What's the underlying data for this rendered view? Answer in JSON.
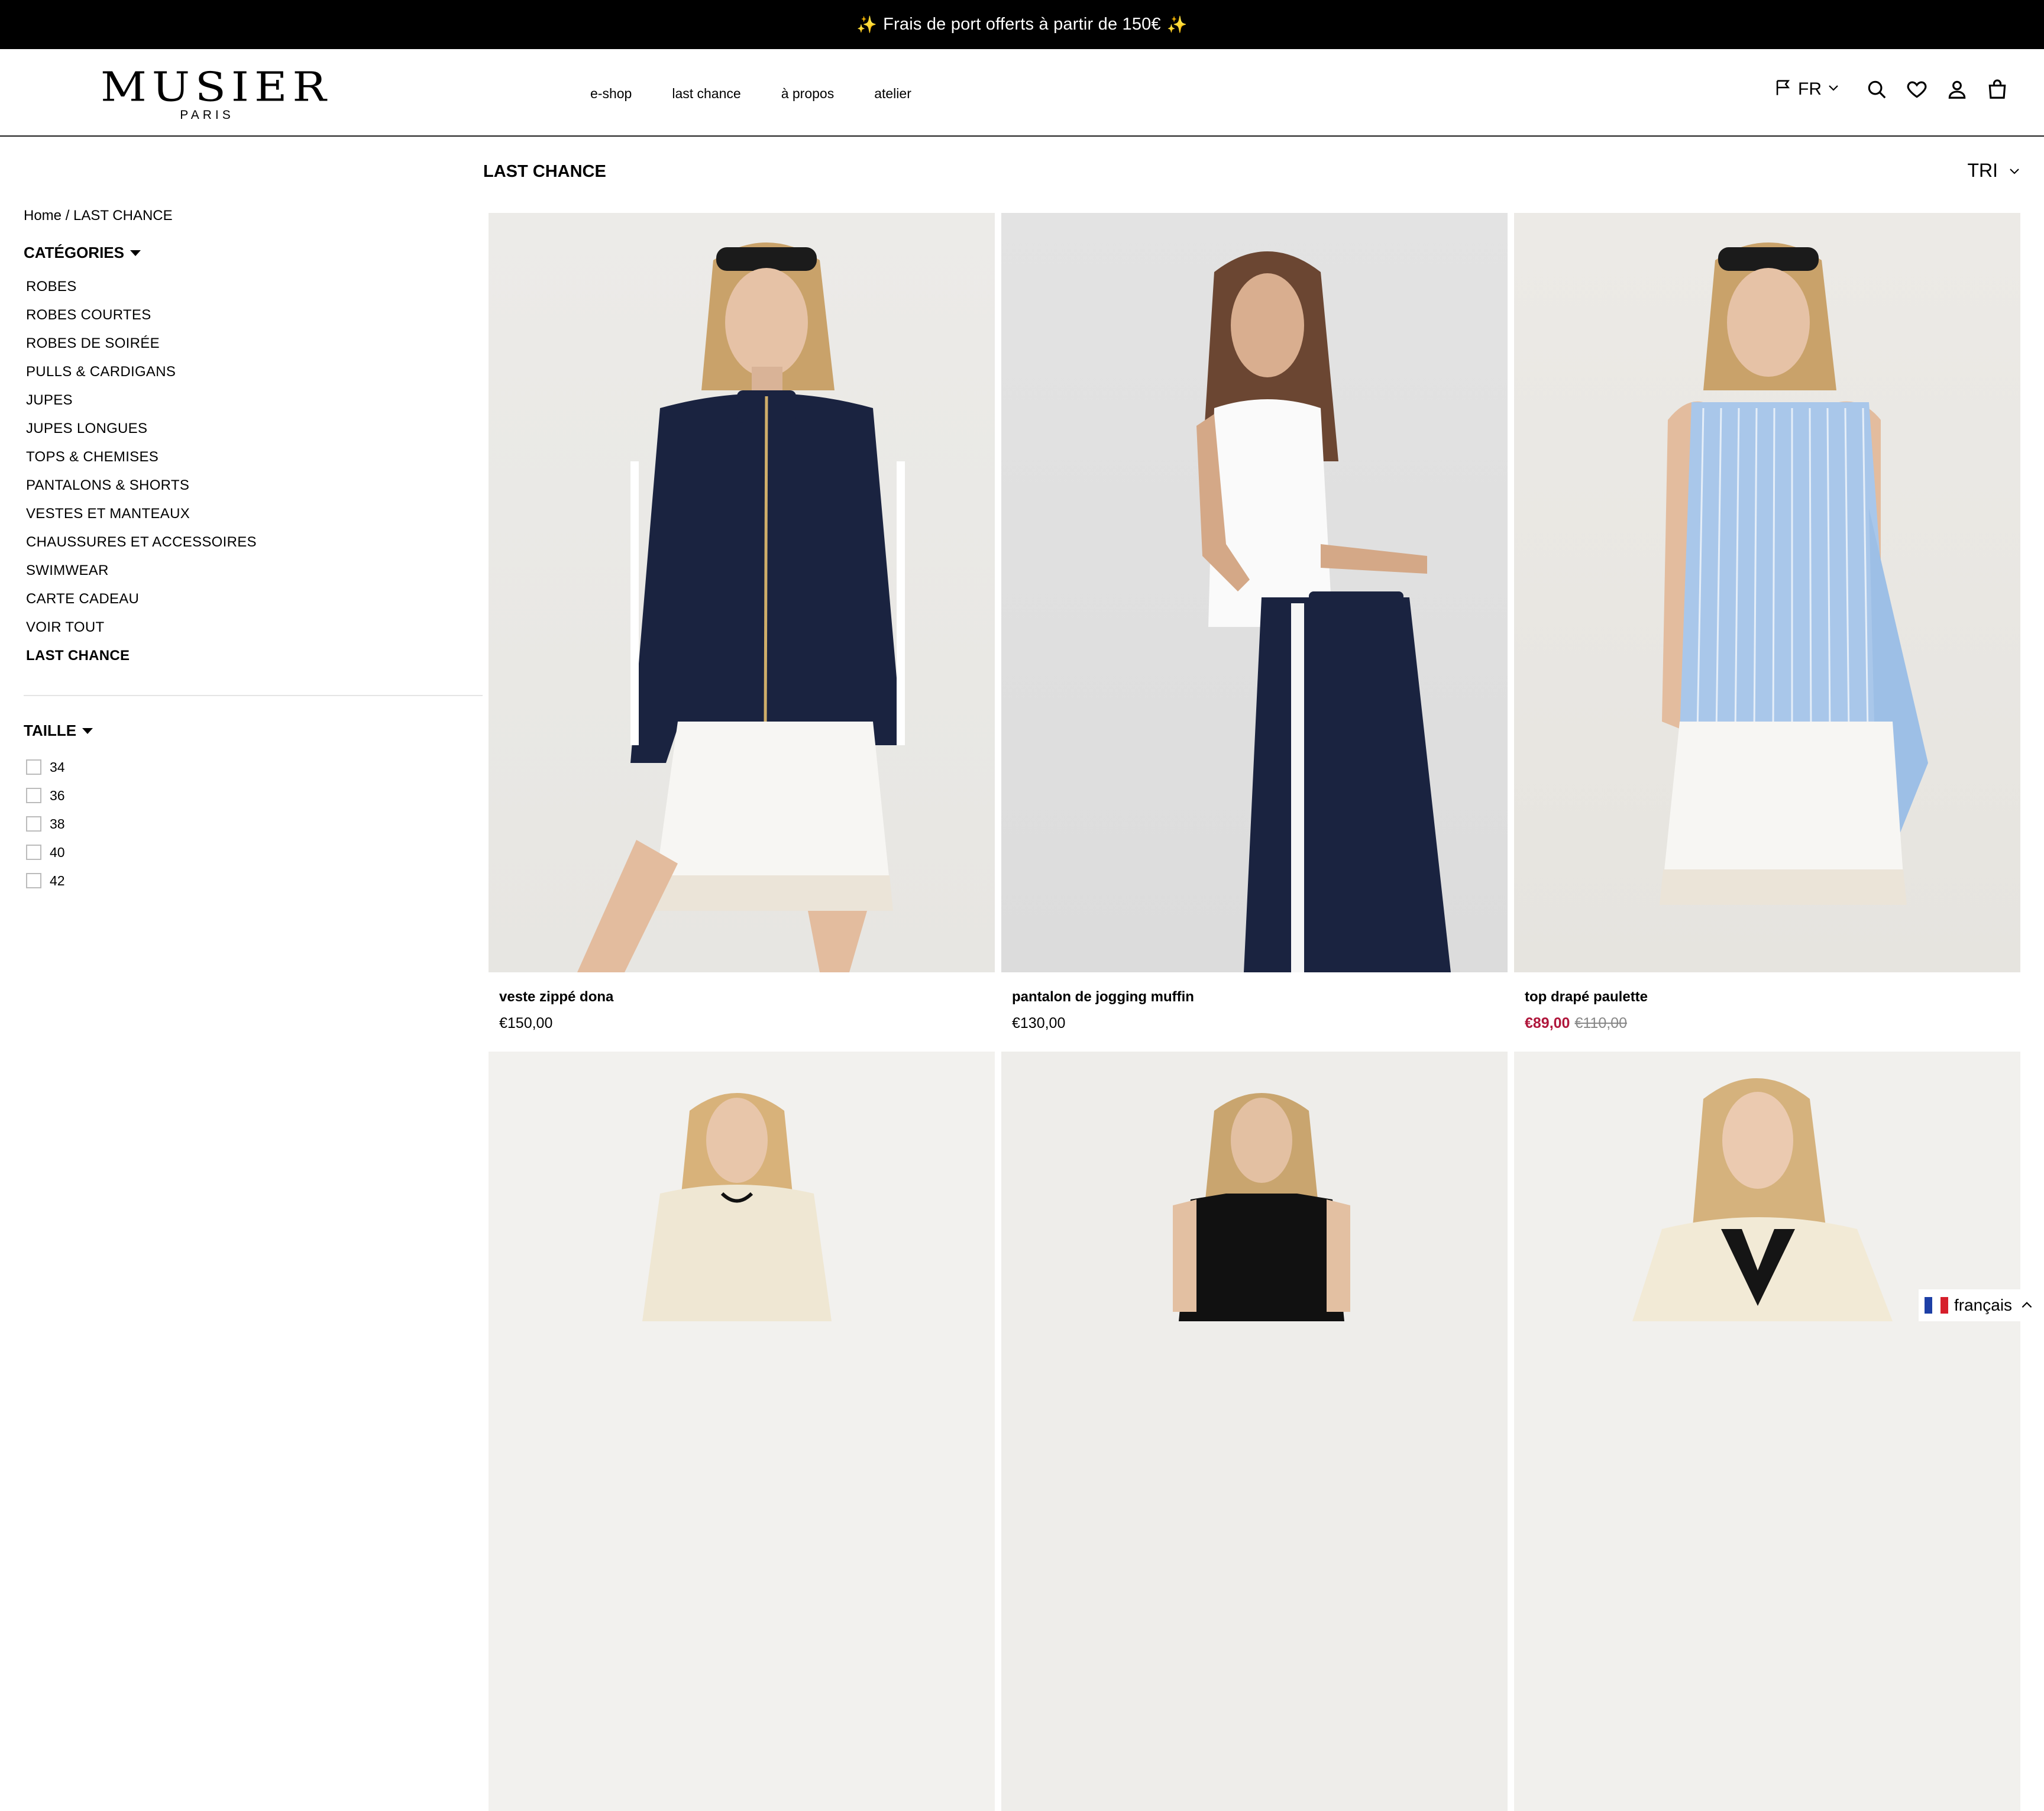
{
  "announcement": {
    "text": "Frais de port offerts à partir de 150€",
    "sparkle": "✨"
  },
  "brand": {
    "name": "MUSIER",
    "sub": "PARIS"
  },
  "nav": [
    {
      "label": "e-shop"
    },
    {
      "label": "last chance"
    },
    {
      "label": "à propos"
    },
    {
      "label": "atelier"
    }
  ],
  "header_tools": {
    "language_code": "FR",
    "icons": [
      "flag-icon",
      "chevron-down-icon",
      "search-icon",
      "heart-icon",
      "account-icon",
      "cart-icon"
    ]
  },
  "breadcrumb": {
    "home": "Home",
    "separator": " / ",
    "current": "LAST CHANCE"
  },
  "categories": {
    "title": "CATÉGORIES",
    "items": [
      {
        "label": "ROBES"
      },
      {
        "label": "ROBES COURTES"
      },
      {
        "label": "ROBES DE SOIRÉE"
      },
      {
        "label": "PULLS & CARDIGANS"
      },
      {
        "label": "JUPES"
      },
      {
        "label": "JUPES LONGUES"
      },
      {
        "label": "TOPS & CHEMISES"
      },
      {
        "label": "PANTALONS & SHORTS"
      },
      {
        "label": "VESTES ET MANTEAUX"
      },
      {
        "label": "CHAUSSURES ET ACCESSOIRES"
      },
      {
        "label": "SWIMWEAR"
      },
      {
        "label": "CARTE CADEAU"
      },
      {
        "label": "VOIR TOUT"
      },
      {
        "label": "LAST CHANCE"
      }
    ]
  },
  "sizes": {
    "title": "TAILLE",
    "options": [
      "34",
      "36",
      "38",
      "40",
      "42"
    ]
  },
  "page_title": "LAST CHANCE",
  "sort": {
    "label": "TRI"
  },
  "products": [
    {
      "name": "veste zippé dona",
      "price": "€150,00"
    },
    {
      "name": "pantalon de jogging muffin",
      "price": "€130,00"
    },
    {
      "name": "top drapé paulette",
      "sale_price": "€89,00",
      "original_price": "€110,00"
    }
  ],
  "language_switcher": {
    "label": "français"
  },
  "colors": {
    "sale": "#b0173c",
    "bar": "#000000",
    "navy": "#1a2340"
  }
}
